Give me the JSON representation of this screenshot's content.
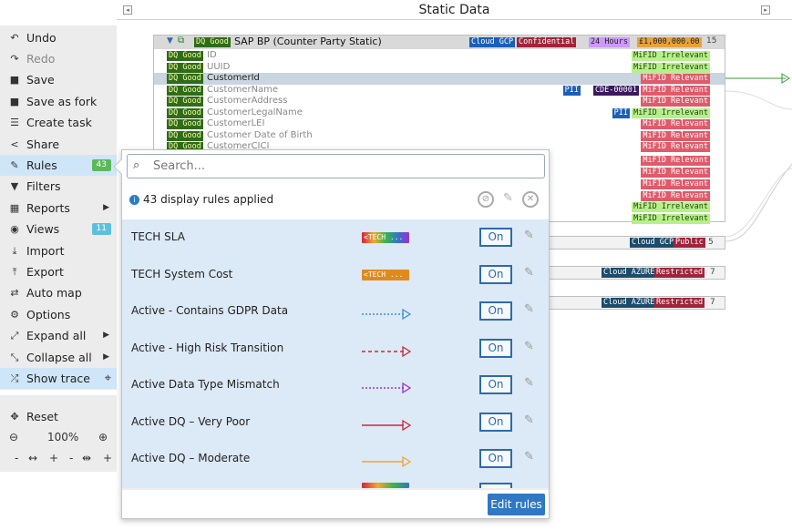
{
  "header": {
    "title": "Static Data"
  },
  "sidebar": {
    "items": [
      {
        "label": "Undo",
        "icon": "undo-icon",
        "glyph": "↶"
      },
      {
        "label": "Redo",
        "icon": "redo-icon",
        "glyph": "↷"
      },
      {
        "label": "Save",
        "icon": "save-icon",
        "glyph": "■"
      },
      {
        "label": "Save as fork",
        "icon": "save-fork-icon",
        "glyph": "■"
      },
      {
        "label": "Create task",
        "icon": "task-icon",
        "glyph": "☰"
      },
      {
        "label": "Share",
        "icon": "share-icon",
        "glyph": "<"
      },
      {
        "label": "Rules",
        "icon": "brush-icon",
        "glyph": "✎",
        "badge": "43"
      },
      {
        "label": "Filters",
        "icon": "filter-icon",
        "glyph": "▼"
      },
      {
        "label": "Reports",
        "icon": "table-icon",
        "glyph": "▦"
      },
      {
        "label": "Views",
        "icon": "camera-icon",
        "glyph": "◉",
        "badge": "11"
      },
      {
        "label": "Import",
        "icon": "import-icon",
        "glyph": "⤓"
      },
      {
        "label": "Export",
        "icon": "export-icon",
        "glyph": "⤒"
      },
      {
        "label": "Auto map",
        "icon": "automap-icon",
        "glyph": "⇄"
      },
      {
        "label": "Options",
        "icon": "gear-icon",
        "glyph": "⚙"
      },
      {
        "label": "Expand all",
        "icon": "expand-icon",
        "glyph": "⤢"
      },
      {
        "label": "Collapse all",
        "icon": "collapse-icon",
        "glyph": "⤡"
      },
      {
        "label": "Show trace",
        "icon": "shuffle-icon",
        "glyph": "⤮"
      }
    ],
    "reset_label": "Reset",
    "zoom_level": "100%"
  },
  "table": {
    "title": "SAP BP (Counter Party Static)",
    "dq_label": "DQ Good",
    "header_tags": {
      "cloud": "Cloud GCP",
      "classification": "Confidential",
      "sla": "24 Hours",
      "cost": "£1,000,000.00",
      "count": "15"
    },
    "rows": [
      {
        "name": "ID",
        "mifid": "MiFID Irrelevant"
      },
      {
        "name": "UUID",
        "mifid": "MiFID Irrelevant"
      },
      {
        "name": "CustomerId",
        "mifid": "MiFID Relevant"
      },
      {
        "name": "CustomerName",
        "mifid": "MiFID Relevant",
        "pii": "PII",
        "cde": "CDE-00001"
      },
      {
        "name": "CustomerAddress",
        "mifid": "MiFID Relevant"
      },
      {
        "name": "CustomerLegalName",
        "mifid": "MiFID Irrelevant",
        "pii": "PII"
      },
      {
        "name": "CustomerLEI",
        "mifid": "MiFID Relevant"
      },
      {
        "name": "Customer Date of Birth",
        "mifid": "MiFID Relevant"
      },
      {
        "name": "CustomerCICI",
        "mifid": "MiFID Relevant"
      }
    ],
    "extra_mifid": [
      "MiFID Relevant",
      "MiFID Relevant",
      "MiFID Relevant",
      "MiFID Relevant",
      "MiFID Irrelevant",
      "MiFID Irrelevant"
    ],
    "other_rows": [
      {
        "cloud": "Cloud GCP",
        "classification": "Public",
        "count": "5"
      },
      {
        "cloud": "Cloud AZURE",
        "classification": "Restricted",
        "count": "7"
      },
      {
        "cloud": "Cloud AZURE",
        "classification": "Restricted",
        "count": "7"
      }
    ]
  },
  "popup": {
    "search_placeholder": "Search...",
    "applied_text": "43 display rules applied",
    "rules": [
      {
        "name": "TECH SLA",
        "sample": "<TECH ...",
        "sample_type": "rainbow",
        "state": "On"
      },
      {
        "name": "TECH System Cost",
        "sample": "<TECH ...",
        "sample_type": "orange",
        "state": "On"
      },
      {
        "name": "Active - Contains GDPR Data",
        "sample_type": "line",
        "color": "#3a8fd6",
        "dash": "2,2",
        "state": "On"
      },
      {
        "name": "Active - High Risk Transition",
        "sample_type": "line",
        "color": "#d0253a",
        "dash": "4,3",
        "state": "On"
      },
      {
        "name": "Active Data Type Mismatch",
        "sample_type": "line",
        "color": "#9b2fd0",
        "dash": "2,2",
        "state": "On"
      },
      {
        "name": "Active DQ – Very Poor",
        "sample_type": "line",
        "color": "#d0253a",
        "dash": "",
        "state": "On"
      },
      {
        "name": "Active DQ – Moderate",
        "sample_type": "line",
        "color": "#f0a830",
        "dash": "",
        "state": "On"
      }
    ],
    "edit_rules_label": "Edit rules"
  },
  "colors": {
    "accent": "#2f78c4",
    "dq_bg": "#2f6b1a",
    "mifid_relevant": "#e05a6a",
    "mifid_irrelevant": "#b7f08a"
  }
}
